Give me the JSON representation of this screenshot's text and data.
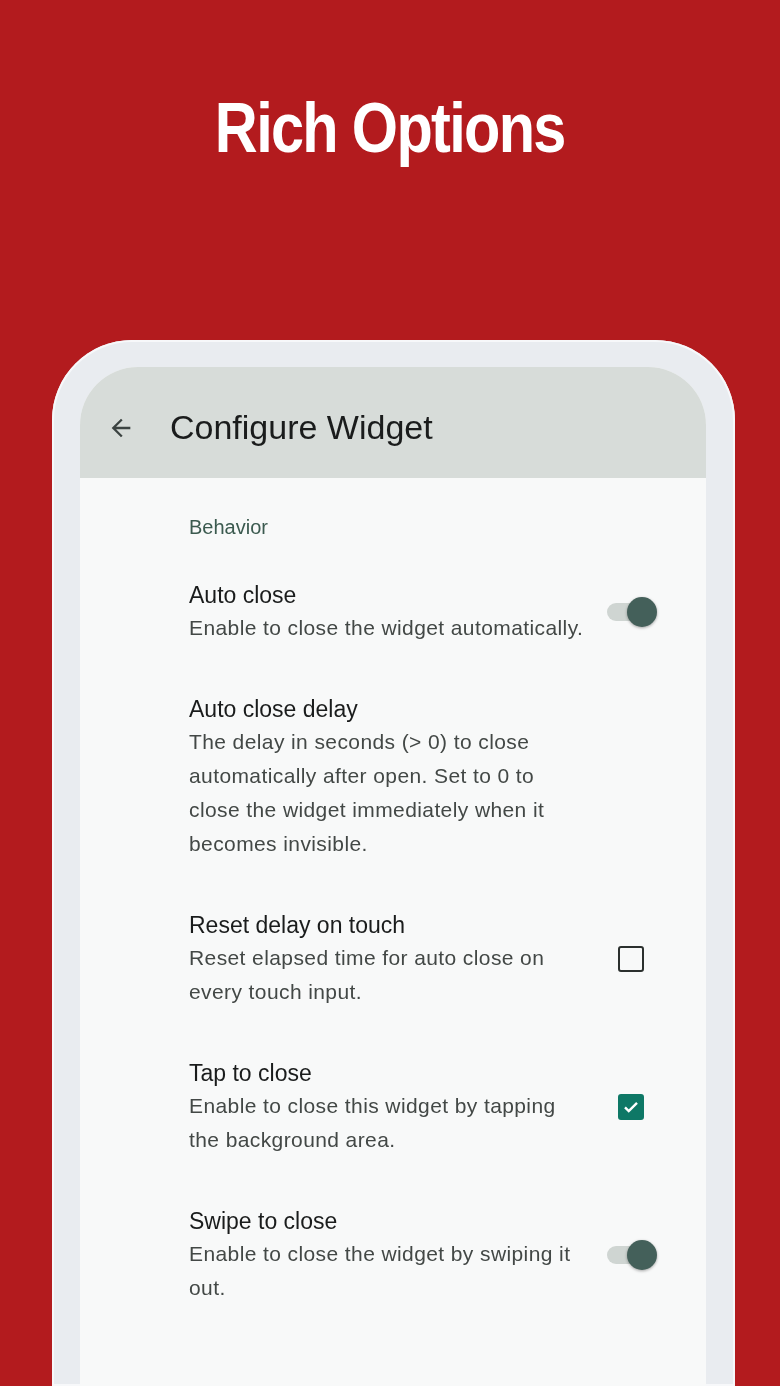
{
  "headline": "Rich Options",
  "app_bar": {
    "title": "Configure Widget"
  },
  "section": "Behavior",
  "settings": [
    {
      "kind": "switch",
      "title": "Auto close",
      "description": "Enable to close the widget automatically.",
      "on": true
    },
    {
      "kind": "plain",
      "title": "Auto close delay",
      "description": "The delay in seconds (> 0) to close automatically after open. Set to 0 to close the widget immediately when it becomes invisible."
    },
    {
      "kind": "checkbox",
      "title": "Reset delay on touch",
      "description": "Reset elapsed time for auto close on every touch input.",
      "checked": false
    },
    {
      "kind": "checkbox",
      "title": "Tap to close",
      "description": "Enable to close this widget by tapping the background area.",
      "checked": true
    },
    {
      "kind": "switch",
      "title": "Swipe to close",
      "description": "Enable to close the widget by swiping it out.",
      "on": true
    }
  ]
}
